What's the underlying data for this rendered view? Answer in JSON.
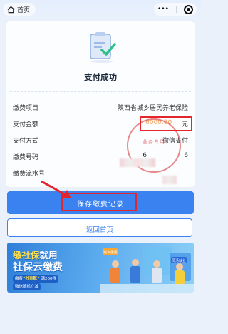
{
  "topbar": {
    "home_label": "首页",
    "more_glyph": "•••"
  },
  "receipt": {
    "title": "支付成功",
    "rows": [
      {
        "label": "缴费项目",
        "value": "陕西省城乡居民养老保险"
      },
      {
        "label": "支付金额",
        "value": "6000.00",
        "unit": "元"
      },
      {
        "label": "支付方式",
        "value": "微信支付"
      },
      {
        "label": "缴费号码",
        "value_start": "6",
        "value_end": "6"
      },
      {
        "label": "缴费流水号",
        "value": ""
      }
    ],
    "stamp_text": "业务专用"
  },
  "actions": {
    "save_label": "保存缴费记录",
    "back_label": "返回首页"
  },
  "banner": {
    "line1_a": "缴社保",
    "line1_b": "就用",
    "line2": "社保云缴费",
    "line3_a": "缴费",
    "line3_b": "“秒到账”",
    "line3_c": "满200得",
    "line4": "微信随机立减",
    "tag1": "城乡居民",
    "tag2": "灵活就业"
  },
  "colors": {
    "primary": "#3a82f0",
    "highlight": "#e3252c",
    "amount": "#f0a05a",
    "success": "#2fbf8a"
  }
}
